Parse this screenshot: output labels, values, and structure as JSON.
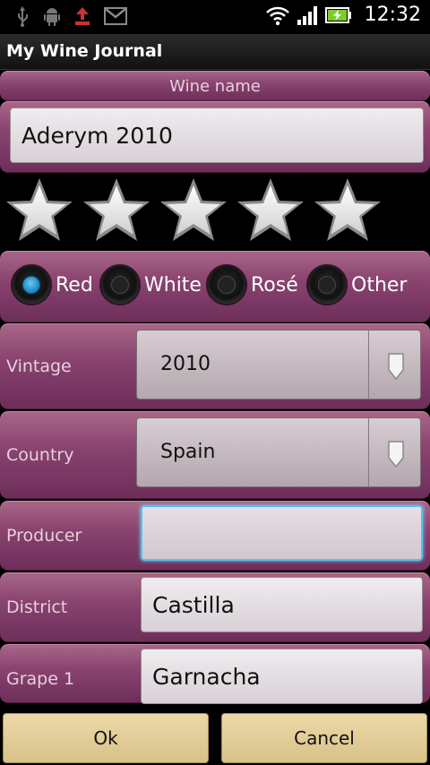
{
  "status_bar": {
    "icons": [
      "usb-icon",
      "android-debug-icon",
      "upload-icon",
      "gmail-icon",
      "wifi-icon",
      "signal-icon",
      "battery-charging-icon"
    ],
    "time": "12:32"
  },
  "app": {
    "title": "My Wine Journal"
  },
  "wine_name": {
    "label": "Wine name",
    "value": "Aderym 2010"
  },
  "rating": {
    "max": 5,
    "value": 0
  },
  "wine_type": {
    "options": [
      {
        "label": "Red",
        "selected": true
      },
      {
        "label": "White",
        "selected": false
      },
      {
        "label": "Rosé",
        "selected": false
      },
      {
        "label": "Other",
        "selected": false
      }
    ]
  },
  "vintage": {
    "label": "Vintage",
    "value": "2010"
  },
  "country": {
    "label": "Country",
    "value": "Spain"
  },
  "producer": {
    "label": "Producer",
    "value": ""
  },
  "district": {
    "label": "District",
    "value": "Castilla"
  },
  "grape1": {
    "label": "Grape 1",
    "value": "Garnacha"
  },
  "buttons": {
    "ok": "Ok",
    "cancel": "Cancel"
  },
  "colors": {
    "panel": "#8a4470",
    "accent_focus": "#4cc4f4",
    "button": "#e2cd98",
    "radio_selected": "#1e88c4"
  }
}
